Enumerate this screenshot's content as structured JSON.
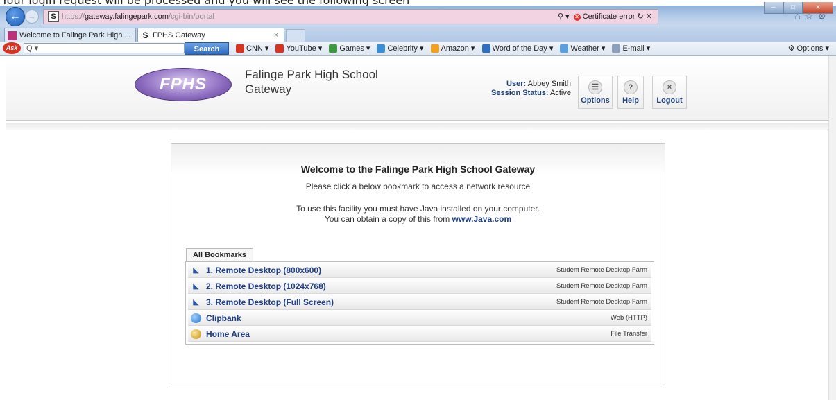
{
  "instruction_text": "Your login request will be processed and you will see the following screen",
  "browser": {
    "url_prefix": "https://",
    "url_host": "gateway.falingepark.com",
    "url_path": "/cgi-bin/portal",
    "cert_error": "Certificate error",
    "window_controls": [
      "–",
      "□",
      "x"
    ],
    "tabs": [
      {
        "label": "Welcome to Falinge Park High ..."
      },
      {
        "label": "FPHS Gateway"
      }
    ],
    "toolbar": {
      "search_placeholder": "Q ▾",
      "search_button": "Search",
      "links": [
        {
          "label": "CNN ▾",
          "color": "#d63323"
        },
        {
          "label": "YouTube ▾",
          "color": "#d63323"
        },
        {
          "label": "Games ▾",
          "color": "#3d9a43"
        },
        {
          "label": "Celebrity ▾",
          "color": "#3b8ed4"
        },
        {
          "label": "Amazon ▾",
          "color": "#f0a21c"
        },
        {
          "label": "Word of the Day ▾",
          "color": "#2e6fbf"
        },
        {
          "label": "Weather ▾",
          "color": "#5aa0e0"
        },
        {
          "label": "E-mail ▾",
          "color": "#8aa0bb"
        }
      ],
      "options": "Options ▾"
    }
  },
  "app": {
    "logo": "FPHS",
    "title_line1": "Falinge Park High School",
    "title_line2": "Gateway",
    "user_label": "User:",
    "user_name": "Abbey Smith",
    "session_label": "Session Status:",
    "session_value": "Active",
    "buttons": [
      {
        "label": "Options",
        "glyph": "☰"
      },
      {
        "label": "Help",
        "glyph": "?"
      },
      {
        "label": "Logout",
        "glyph": "×"
      }
    ]
  },
  "welcome": {
    "title": "Welcome to the Falinge Park High School Gateway",
    "subtitle": "Please click a below bookmark to access a network resource",
    "java_line1": "To use this facility you must have Java installed on your computer.",
    "java_line2": "You can obtain a copy of this from",
    "java_link": "www.Java.com"
  },
  "bookmarks": {
    "tab_label": "All Bookmarks",
    "items": [
      {
        "label": "1. Remote Desktop (800x600)",
        "type": "Student Remote Desktop Farm",
        "icon": "remote-desktop-icon"
      },
      {
        "label": "2. Remote Desktop (1024x768)",
        "type": "Student Remote Desktop Farm",
        "icon": "remote-desktop-icon"
      },
      {
        "label": "3. Remote Desktop (Full Screen)",
        "type": "Student Remote Desktop Farm",
        "icon": "remote-desktop-icon"
      },
      {
        "label": "Clipbank",
        "type": "Web (HTTP)",
        "icon": "globe-icon"
      },
      {
        "label": "Home Area",
        "type": "File Transfer",
        "icon": "file-transfer-icon"
      }
    ]
  }
}
